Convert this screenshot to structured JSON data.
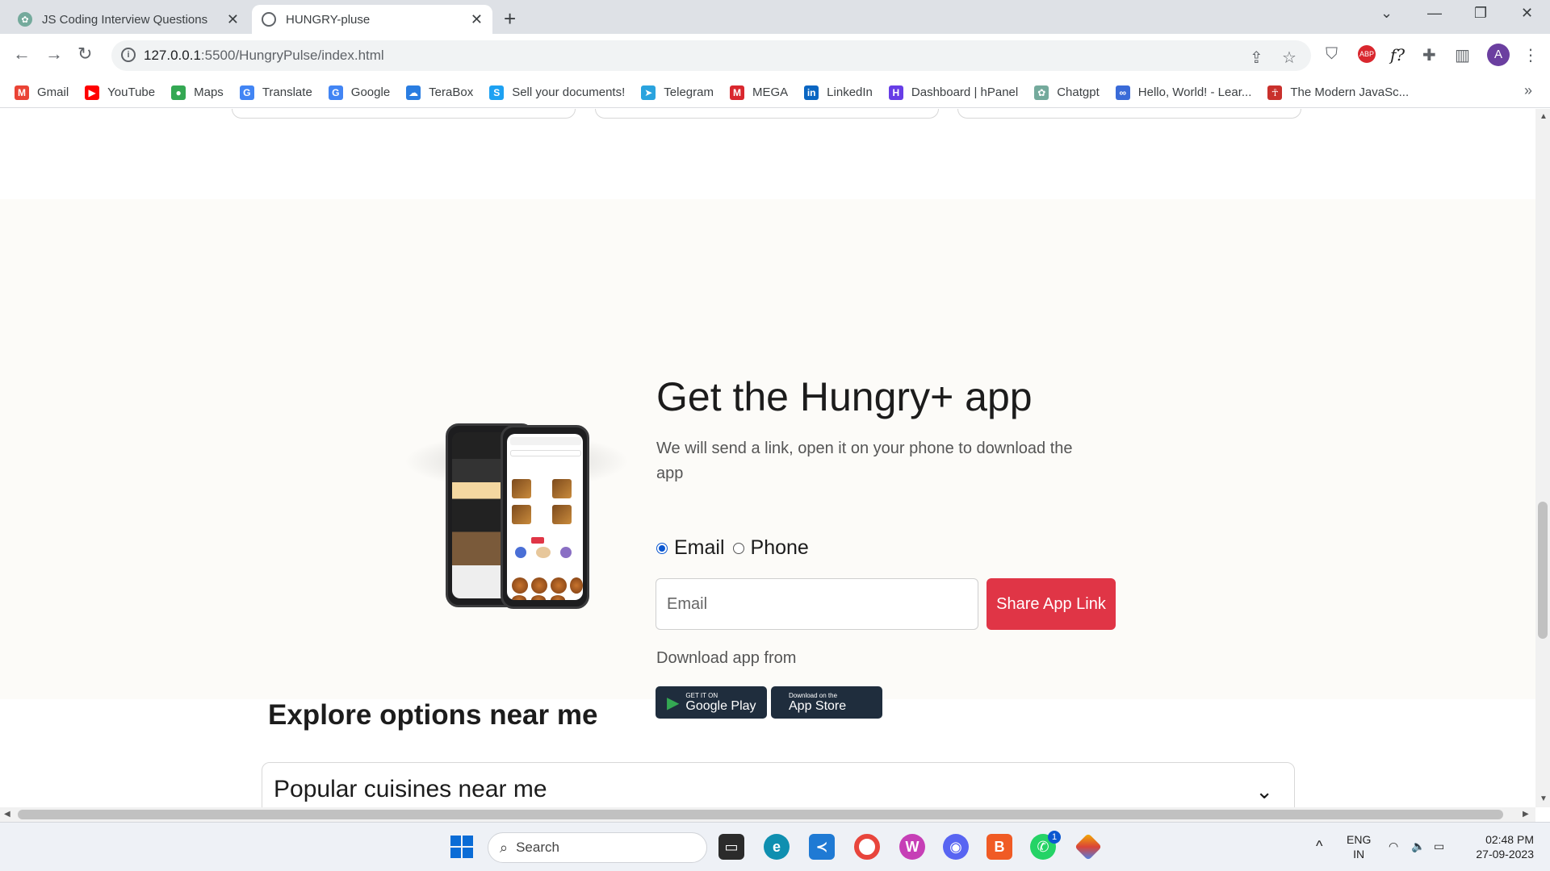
{
  "browser": {
    "tabs": [
      {
        "title": "JS Coding Interview Questions",
        "close": "✕"
      },
      {
        "title": "HUNGRY-pluse",
        "close": "✕"
      }
    ],
    "new_tab": "+",
    "url_host": "127.0.0.1",
    "url_path": ":5500/HungryPulse/index.html",
    "profile_initial": "A",
    "bookmarks": [
      {
        "label": "Gmail",
        "icon": "gmail-icon",
        "color": "#ea4335",
        "glyph": "M"
      },
      {
        "label": "YouTube",
        "icon": "youtube-icon",
        "color": "#ff0000",
        "glyph": "▶"
      },
      {
        "label": "Maps",
        "icon": "maps-icon",
        "color": "#34a853",
        "glyph": "●"
      },
      {
        "label": "Translate",
        "icon": "translate-icon",
        "color": "#4285f4",
        "glyph": "G"
      },
      {
        "label": "Google",
        "icon": "google-icon",
        "color": "#4285f4",
        "glyph": "G"
      },
      {
        "label": "TeraBox",
        "icon": "terabox-icon",
        "color": "#2a7de1",
        "glyph": "☁"
      },
      {
        "label": "Sell your documents!",
        "icon": "sell-docs-icon",
        "color": "#1da1f2",
        "glyph": "S"
      },
      {
        "label": "Telegram",
        "icon": "telegram-icon",
        "color": "#2aa3de",
        "glyph": "➤"
      },
      {
        "label": "MEGA",
        "icon": "mega-icon",
        "color": "#d9272e",
        "glyph": "M"
      },
      {
        "label": "LinkedIn",
        "icon": "linkedin-icon",
        "color": "#0a66c2",
        "glyph": "in"
      },
      {
        "label": "Dashboard | hPanel",
        "icon": "hostinger-icon",
        "color": "#673de6",
        "glyph": "H"
      },
      {
        "label": "Chatgpt",
        "icon": "chatgpt-icon",
        "color": "#74aa9c",
        "glyph": "✿"
      },
      {
        "label": "Hello, World! - Lear...",
        "icon": "programiz-icon",
        "color": "#3a6bd8",
        "glyph": "∞"
      },
      {
        "label": "The Modern JavaSc...",
        "icon": "javascript-info-icon",
        "color": "#c9302c",
        "glyph": "☥"
      }
    ],
    "bookmarks_more": "»"
  },
  "page": {
    "app_title": "Get the Hungry+ app",
    "app_subtitle": "We will send a link, open it on your phone to download the app",
    "radio_email": "Email",
    "radio_phone": "Phone",
    "input_placeholder": "Email",
    "share_button": "Share App Link",
    "download_label": "Download app from",
    "google_play_small": "GET IT ON",
    "google_play_big": "Google Play",
    "app_store_small": "Download on the",
    "app_store_big": "App Store",
    "explore_title": "Explore options near me",
    "accordion_label": "Popular cuisines near me"
  },
  "taskbar": {
    "search_label": "Search",
    "language": "ENG",
    "region": "IN",
    "time": "02:48 PM",
    "date": "27-09-2023",
    "whatsapp_badge": "1"
  },
  "colors": {
    "accent_red": "#e03546",
    "radio_blue": "#0b57d0"
  }
}
